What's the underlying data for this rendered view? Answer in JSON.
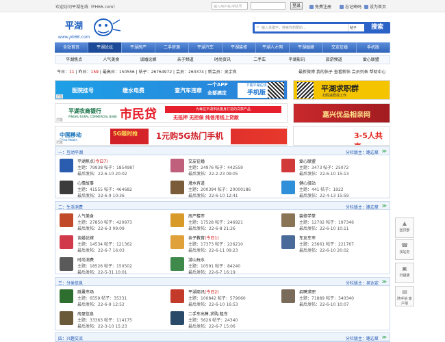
{
  "topbar": {
    "welcome": "欢迎访问平湖在线（PH66.com）",
    "user_placeholder": "输入用户名/手机号",
    "login": "登录",
    "free_reg": "免费注册",
    "forgot": "忘记密码",
    "homepage": "设为首页"
  },
  "logo": {
    "text": "平湖",
    "url": "www.ph66.com"
  },
  "search": {
    "placeholder": "输入关键字，搜索你想要的...",
    "scope": "帖子",
    "button": "搜索"
  },
  "nav": [
    "全站首页",
    "平湖论坛",
    "平湖房产",
    "二手房源",
    "平湖汽车",
    "平湖装修",
    "平湖人才网",
    "平湖婚嫁",
    "交友征婚",
    "手机版"
  ],
  "subnav": [
    "平湖焦点",
    "人气美食",
    "谈婚论嫁",
    "亲子频道",
    "时尚资讯",
    "二手车",
    "平湖影讯",
    "旅游频道",
    "爱心联盟"
  ],
  "stats": {
    "today_l": "今日：",
    "today": "11",
    "yest_l": "昨日：",
    "yest": "159",
    "max_l": "最高日：",
    "max": "150556",
    "posts_l": "帖子：",
    "posts": "26764972",
    "members_l": "会员：",
    "members": "263374",
    "newest_l": "新会员：",
    "newest": "吴宇良"
  },
  "quick": "最新微博 我的帖子 查看新帖 会员列表 帮助中心",
  "banners": {
    "hospital": "医院挂号",
    "elec": "缴水电费",
    "car": "查汽车违章",
    "app_a": "一个APP",
    "app_b": "全部搞定",
    "app_c": "下载平湖在线",
    "app_d": "手机版",
    "job": "平湖求职群",
    "job_s": "扫码进群找工作",
    "bank": "平湖农商银行",
    "bank_en": "PINGHU RURAL COMMERCIAL BANK",
    "loan": "市民贷",
    "loan_red": "为每位平湖市民量身打造的贷款产品",
    "loan_sub": "无抵押 无担保 纯信用线上贷款",
    "goods": "嘉兴优品相亲网",
    "cm": "中国移动",
    "cm_en": "China Mobile",
    "promo_a": "5G限时抢",
    "promo_b": "1元购5G热门手机",
    "telecom": "3-5人共享",
    "ad": "广告"
  },
  "sections": [
    {
      "title": "一：互动平湖",
      "mod": "分栏版主：路边草",
      "collapse": "≫",
      "forums": [
        {
          "name": "平湖焦点",
          "badge": "(今日7)",
          "l2": "主题：79938  帖子：1854987",
          "l3": "最后发帖：22-6-10 20:02",
          "color": "#2a5db0"
        },
        {
          "name": "交友征婚",
          "badge": "",
          "l2": "主题：24976  帖子：442559",
          "l3": "最后发帖：22-2-23 09:05",
          "color": "#c0607d"
        },
        {
          "name": "爱心联盟",
          "badge": "",
          "l2": "主题：3473  帖子：25072",
          "l3": "最后发帖：22-6-10 15:13",
          "color": "#d23a3a"
        },
        {
          "name": "心情故事",
          "badge": "",
          "l2": "主题：41555  帖子：464682",
          "l3": "最后发帖：22-6-9 10:36",
          "color": "#3c3c3c"
        },
        {
          "name": "灌水有道",
          "badge": "",
          "l2": "主题：200394  帖子：20000186",
          "l3": "最后发帖：22-6-10 12:41",
          "color": "#7b5c3a"
        },
        {
          "name": "健心驿站",
          "badge": "",
          "l2": "主题：441  帖子：1922",
          "l3": "最后发帖：22-4-13 15:59",
          "color": "#2f8fd8"
        }
      ]
    },
    {
      "title": "二：生活消费",
      "mod": "分栏版主：路边草",
      "collapse": "≫",
      "forums": [
        {
          "name": "人气美食",
          "badge": "",
          "l2": "主题：27850  帖子：420973",
          "l3": "最后发帖：22-6-3 09:09",
          "color": "#c04a2a"
        },
        {
          "name": "房产楼市",
          "badge": "",
          "l2": "主题：17528  帖子：246921",
          "l3": "最后发帖：22-6-8 21:26",
          "color": "#d89b2a"
        },
        {
          "name": "装修学堂",
          "badge": "",
          "l2": "主题：12702  帖子：197346",
          "l3": "最后发帖：22-6-10 10:11",
          "color": "#8a7456"
        },
        {
          "name": "谈婚论嫁",
          "badge": "",
          "l2": "主题：14534  帖子：121362",
          "l3": "最后发帖：22-6-7 16:03",
          "color": "#d13a4a"
        },
        {
          "name": "亲子教育",
          "badge": "(今日1)",
          "l2": "主题：17373  帖子：226210",
          "l3": "最后发帖：22-6-11 09:23",
          "color": "#e0a03a"
        },
        {
          "name": "车友车市",
          "badge": "",
          "l2": "主题：23661  帖子：221767",
          "l3": "最后发帖：22-6-10 20:02",
          "color": "#4a6b9a"
        },
        {
          "name": "时尚消费",
          "badge": "",
          "l2": "主题：18526  帖子：150502",
          "l3": "最后发帖：22-5-31 10:01",
          "color": "#5a5a5a"
        },
        {
          "name": "游山玩水",
          "badge": "",
          "l2": "主题：10591  帖子：84240",
          "l3": "最后发帖：22-6-7 16:19",
          "color": "#3f8a4a"
        }
      ]
    },
    {
      "title": "三：分类信息",
      "mod": "分栏版主：吴达定",
      "collapse": "≫",
      "forums": [
        {
          "name": "跳蚤市场",
          "badge": "",
          "l2": "主题：6559  帖子：35331",
          "l3": "最后发帖：22-6-9 12:52",
          "color": "#2e6e2e"
        },
        {
          "name": "平湖商讯",
          "badge": "(今日2)",
          "l2": "主题：100842  帖子：579060",
          "l3": "最后发帖：22-6-10 16:53",
          "color": "#c33a2a"
        },
        {
          "name": "招聘求职",
          "badge": "",
          "l2": "主题：71889  帖子：340340",
          "l3": "最后发帖：22-6-10 10:07",
          "color": "#7a6a5a"
        },
        {
          "name": "房屋信息",
          "badge": "",
          "l2": "主题：33363  帖子：114175",
          "l3": "最后发帖：22-3-10 15:23",
          "color": "#6a5a3a"
        },
        {
          "name": "二手车出售,求购,租车",
          "badge": "",
          "l2": "主题：5626  帖子：24340",
          "l3": "最后发帖：22-6-7 15:06",
          "color": "#2a4a6a"
        }
      ]
    },
    {
      "title": "四：兴趣交流",
      "mod": "分栏版主：路边草",
      "collapse": "≫",
      "forums": []
    }
  ],
  "side": [
    {
      "label": "回顶部",
      "icon": "▲"
    },
    {
      "label": "找站务",
      "icon": "☎"
    },
    {
      "label": "扫描版",
      "icon": "▣"
    },
    {
      "label": "随手拍 客户端",
      "icon": "▤"
    }
  ]
}
